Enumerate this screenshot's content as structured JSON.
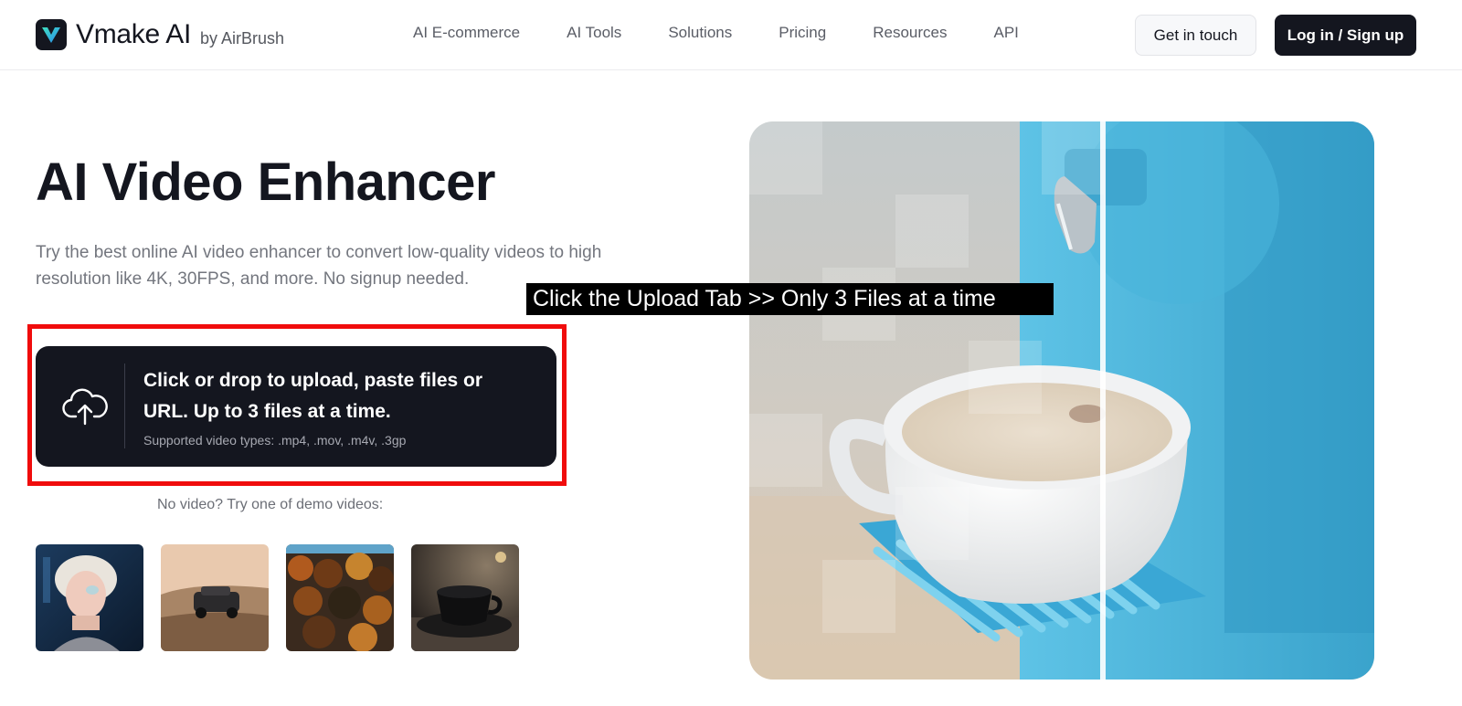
{
  "header": {
    "logo_word": "Vmake AI",
    "logo_by": "by AirBrush",
    "nav": [
      "AI E-commerce",
      "AI Tools",
      "Solutions",
      "Pricing",
      "Resources",
      "API"
    ],
    "get_in_touch": "Get in touch",
    "login": "Log in / Sign up"
  },
  "hero": {
    "title": "AI Video Enhancer",
    "subtitle": "Try the best online AI video enhancer to convert low-quality videos to high resolution like 4K, 30FPS, and more. No signup needed.",
    "upload_main": "Click or drop to upload, paste files or URL. Up to 3 files at a time.",
    "upload_types": "Supported video types: .mp4, .mov, .m4v, .3gp",
    "demo_label": "No video? Try one of demo videos:"
  },
  "overlay": {
    "caption": "Click the Upload Tab >> Only 3 Files at a time"
  },
  "icons": {
    "upload": "cloud-upload-icon",
    "logo": "vmake-logo-icon"
  },
  "colors": {
    "primary_dark": "#14161f",
    "highlight_red": "#f00c0c",
    "machine_blue": "#56bde0"
  }
}
